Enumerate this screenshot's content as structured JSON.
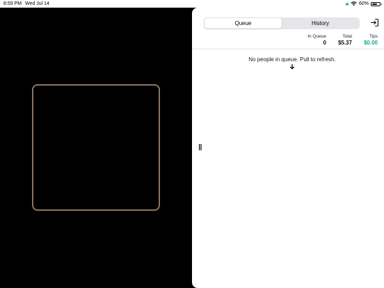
{
  "status_bar": {
    "time": "8:59 PM",
    "date": "Wed Jul 14",
    "battery": "60%",
    "indicator_color": "#34c759"
  },
  "panel": {
    "tabs": [
      {
        "label": "Queue",
        "selected": true
      },
      {
        "label": "History",
        "selected": false
      }
    ],
    "exit_icon": "exit-icon",
    "stats": {
      "in_queue_label": "In Queue",
      "in_queue_value": "0",
      "total_label": "Total",
      "total_value": "$5.37",
      "tips_label": "Tips",
      "tips_value": "$0.00"
    },
    "empty_message": "No people in queue. Pull to refresh.",
    "refresh_icon": "arrow-down-icon"
  },
  "colors": {
    "accent_tips": "#1fa497",
    "scan_frame": "#8a7660"
  }
}
